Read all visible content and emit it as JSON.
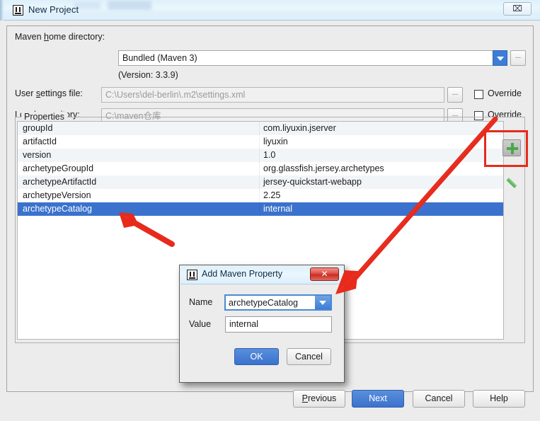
{
  "window": {
    "title": "New Project",
    "app_icon": "intellij-idea-icon",
    "close_label": "⌧"
  },
  "form": {
    "maven_home": {
      "label_pre": "Maven ",
      "label_mnemonic": "h",
      "label_post": "ome directory:",
      "label_full": "Maven home directory:",
      "value": "Bundled (Maven 3)",
      "version_note": "(Version: 3.3.9)",
      "browse_label": "..."
    },
    "user_settings": {
      "label_full": "User settings file:",
      "value": "C:\\Users\\del-berlin\\.m2\\settings.xml",
      "browse_label": "...",
      "override_label": "Override",
      "override_checked": false
    },
    "local_repository": {
      "label_full": "Local repository:",
      "value": "C:\\maven仓库",
      "browse_label": "...",
      "override_label": "Override",
      "override_checked": false
    }
  },
  "properties_panel": {
    "legend": "Properties",
    "add_button_tooltip": "Add",
    "edit_button_tooltip": "Edit",
    "rows": [
      {
        "key": "groupId",
        "value": "com.liyuxin.jserver",
        "selected": false
      },
      {
        "key": "artifactId",
        "value": "liyuxin",
        "selected": false
      },
      {
        "key": "version",
        "value": "1.0",
        "selected": false
      },
      {
        "key": "archetypeGroupId",
        "value": "org.glassfish.jersey.archetypes",
        "selected": false
      },
      {
        "key": "archetypeArtifactId",
        "value": "jersey-quickstart-webapp",
        "selected": false
      },
      {
        "key": "archetypeVersion",
        "value": "2.25",
        "selected": false
      },
      {
        "key": "archetypeCatalog",
        "value": "internal",
        "selected": true
      }
    ]
  },
  "dialog": {
    "title": "Add Maven Property",
    "icon": "intellij-idea-icon",
    "close_label": "✕",
    "name_label": "Name",
    "name_value": "archetypeCatalog",
    "value_label": "Value",
    "value_value": "internal",
    "ok_label": "OK",
    "cancel_label": "Cancel"
  },
  "footer": {
    "previous_label": "Previous",
    "next_label": "Next",
    "cancel_label": "Cancel",
    "help_label": "Help"
  },
  "colors": {
    "accent_blue": "#3a72cd",
    "selection_blue": "#3a72cd",
    "annotation_red": "#e72a1b",
    "titlebar_blue": "#dff0fa",
    "panel_gray": "#ececec",
    "row_alt": "#f2f5f8",
    "add_icon_green": "#4aa84a"
  }
}
